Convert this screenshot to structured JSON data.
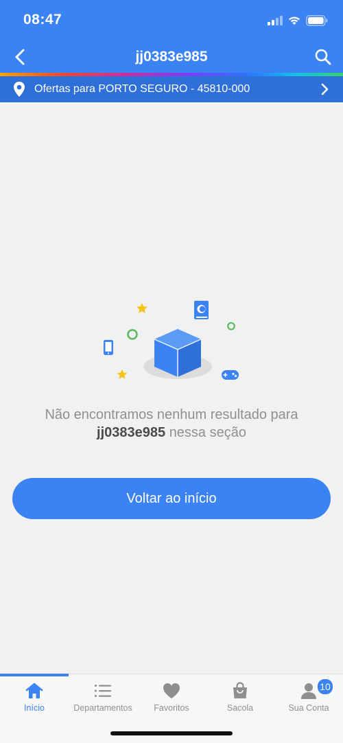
{
  "status_bar": {
    "time": "08:47"
  },
  "header": {
    "title": "jj0383e985",
    "back_icon": "chevron-left-icon",
    "search_icon": "search-icon"
  },
  "location": {
    "text": "Ofertas para PORTO SEGURO - 45810-000",
    "icon": "location-pin-icon"
  },
  "empty_state": {
    "message_prefix": "Não encontramos nenhum resultado para",
    "query": "jj0383e985",
    "message_suffix": "nessa seção",
    "button_label": "Voltar ao início"
  },
  "bottom_nav": {
    "items": [
      {
        "label": "Início",
        "icon": "home-icon",
        "active": true
      },
      {
        "label": "Departamentos",
        "icon": "list-icon",
        "active": false
      },
      {
        "label": "Favoritos",
        "icon": "heart-icon",
        "active": false
      },
      {
        "label": "Sacola",
        "icon": "bag-icon",
        "active": false
      },
      {
        "label": "Sua Conta",
        "icon": "user-icon",
        "active": false,
        "badge": "10"
      }
    ]
  },
  "colors": {
    "primary": "#3b82f2",
    "location_bar": "#2f6fd9",
    "background": "#f1f1f1",
    "muted_text": "#8f8f8f",
    "star": "#f5c518",
    "ring": "#5cb85c"
  }
}
